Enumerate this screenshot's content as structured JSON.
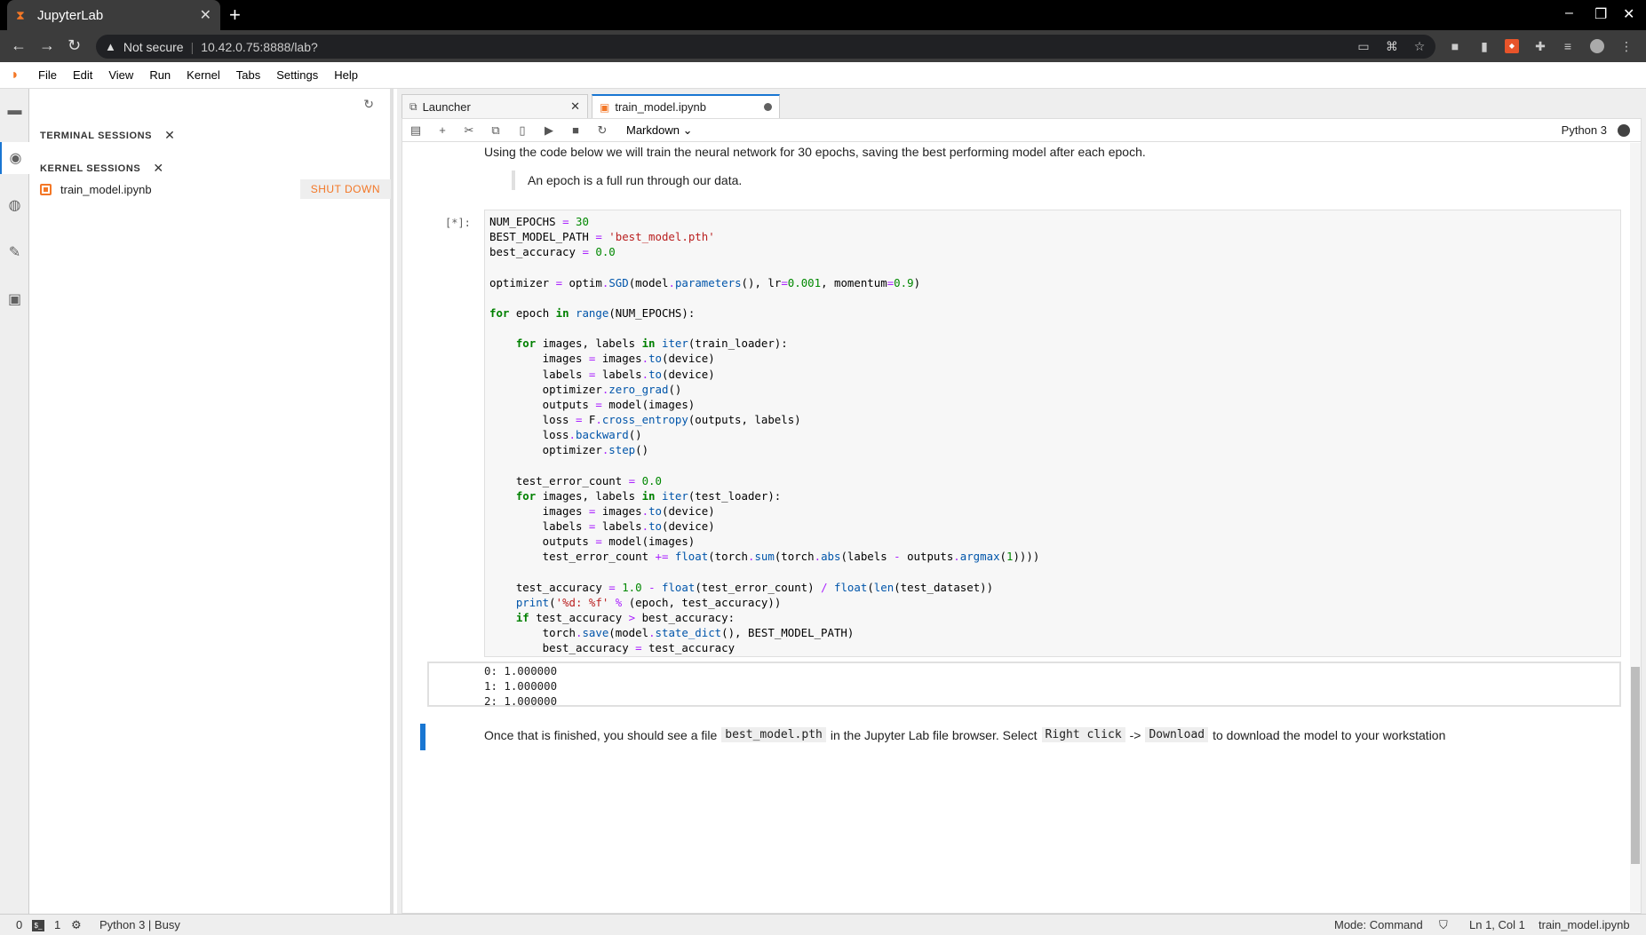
{
  "browser": {
    "tab_title": "JupyterLab",
    "security": "Not secure",
    "url": "10.42.0.75:8888/lab?"
  },
  "menu": {
    "items": [
      "File",
      "Edit",
      "View",
      "Run",
      "Kernel",
      "Tabs",
      "Settings",
      "Help"
    ]
  },
  "sidebar": {
    "terminal_sessions": "TERMINAL SESSIONS",
    "kernel_sessions": "KERNEL SESSIONS",
    "session_name": "train_model.ipynb",
    "shutdown_label": "SHUT DOWN"
  },
  "tabs": {
    "launcher": "Launcher",
    "notebook": "train_model.ipynb"
  },
  "toolbar": {
    "cell_type": "Markdown",
    "kernel_name": "Python 3"
  },
  "cells": {
    "md1": "Using the code below we will train the neural network for 30 epochs, saving the best performing model after each epoch.",
    "quote": "An epoch is a full run through our data.",
    "prompt": "[*]:",
    "output": "0: 1.000000\n1: 1.000000\n2: 1.000000",
    "md2_a": "Once that is finished, you should see a file",
    "md2_code1": "best_model.pth",
    "md2_b": "in the Jupyter Lab file browser. Select",
    "md2_code2": "Right click",
    "md2_arrow": "->",
    "md2_code3": "Download",
    "md2_c": "to download the model to your workstation"
  },
  "status": {
    "count0": "0",
    "count1": "1",
    "kernel": "Python 3 | Busy",
    "mode": "Mode: Command",
    "position": "Ln 1, Col 1",
    "file": "train_model.ipynb"
  }
}
